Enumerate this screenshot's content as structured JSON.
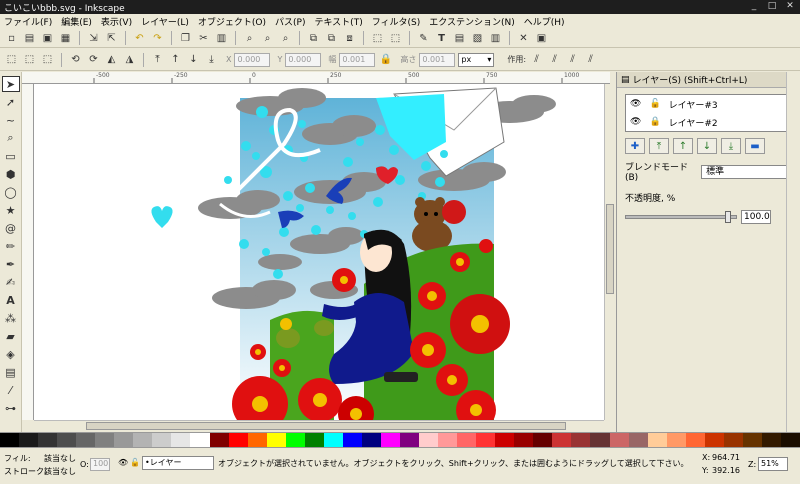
{
  "window": {
    "title": "こいこいbbb.svg - Inkscape"
  },
  "menu": [
    "ファイル(F)",
    "編集(E)",
    "表示(V)",
    "レイヤー(L)",
    "オブジェクト(O)",
    "パス(P)",
    "テキスト(T)",
    "フィルタ(S)",
    "エクステンション(N)",
    "ヘルプ(H)"
  ],
  "coords": {
    "x_label": "X",
    "x_value": "0.000",
    "y_label": "Y",
    "y_value": "0.000",
    "w_label": "幅",
    "w_value": "0.001",
    "h_label": "高さ",
    "h_value": "0.001",
    "unit": "px",
    "action_label": "作用:"
  },
  "ruler": {
    "ticks": [
      "-500",
      "-250",
      "0",
      "250",
      "500",
      "750",
      "1000"
    ]
  },
  "panel": {
    "title": "レイヤー(S) (Shift+Ctrl+L)",
    "layers": [
      {
        "name": "レイヤー#3",
        "locked": false
      },
      {
        "name": "レイヤー#2",
        "locked": true
      }
    ],
    "blend_label": "ブレンドモード(B)",
    "blend_value": "標準",
    "opacity_label": "不透明度, %",
    "opacity_value": "100.0",
    "opacity_fraction": 0.95
  },
  "status": {
    "fill_label": "フィル:",
    "fill_value": "該当なし",
    "stroke_label": "ストローク:",
    "stroke_value": "該当なし",
    "opacity_label": "O:",
    "opacity_value": "100",
    "layer_value": "•レイヤー",
    "message": "オブジェクトが選択されていません。オブジェクトをクリック、Shift+クリック、または囲むようにドラッグして選択して下さい。",
    "x_label": "X:",
    "x_value": "964.71",
    "y_label": "Y:",
    "y_value": "392.16",
    "zoom_label": "Z:",
    "zoom_value": "51%"
  },
  "palette": [
    "#000000",
    "#1a1a1a",
    "#333333",
    "#4d4d4d",
    "#666666",
    "#808080",
    "#999999",
    "#b3b3b3",
    "#cccccc",
    "#e6e6e6",
    "#ffffff",
    "#800000",
    "#ff0000",
    "#ff6600",
    "#ffff00",
    "#00ff00",
    "#008000",
    "#00ffff",
    "#0000ff",
    "#000080",
    "#ff00ff",
    "#800080",
    "#ffcccc",
    "#ff9999",
    "#ff6666",
    "#ff3333",
    "#cc0000",
    "#990000",
    "#660000",
    "#cc3333",
    "#993333",
    "#663333",
    "#cc6666",
    "#996666",
    "#ffcc99",
    "#ff9966",
    "#ff6633",
    "#cc3300",
    "#993300",
    "#663300",
    "#331a00",
    "#1a0d00"
  ]
}
